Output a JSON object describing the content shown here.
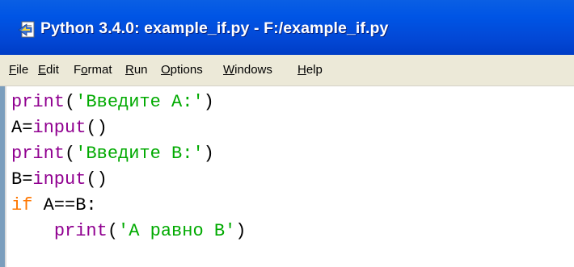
{
  "window": {
    "title": "Python 3.4.0: example_if.py - F:/example_if.py",
    "icon": "python-file-icon"
  },
  "menu": [
    {
      "pre": "",
      "u": "F",
      "post": "ile"
    },
    {
      "pre": "",
      "u": "E",
      "post": "dit"
    },
    {
      "pre": "F",
      "u": "o",
      "post": "rmat"
    },
    {
      "pre": "",
      "u": "R",
      "post": "un"
    },
    {
      "pre": "",
      "u": "O",
      "post": "ptions"
    },
    {
      "pre": "",
      "u": "W",
      "post": "indows"
    },
    {
      "pre": "",
      "u": "H",
      "post": "elp"
    }
  ],
  "code": {
    "l1": {
      "builtin": "print",
      "open": "(",
      "string": "'Введите A:'",
      "close": ")"
    },
    "l2": {
      "lhs": "A=",
      "builtin": "input",
      "rest": "()"
    },
    "l3": {
      "builtin": "print",
      "open": "(",
      "string": "'Введите B:'",
      "close": ")"
    },
    "l4": {
      "lhs": "B=",
      "builtin": "input",
      "rest": "()"
    },
    "l5": {
      "keyword": "if",
      "rest": " A==B:"
    },
    "l6": {
      "indent": "    ",
      "builtin": "print",
      "open": "(",
      "string": "'A равно B'",
      "close": ")"
    }
  },
  "colors": {
    "keyword": "#ff7700",
    "builtin": "#900090",
    "string": "#00aa00",
    "titlebar": "#0055e5"
  }
}
